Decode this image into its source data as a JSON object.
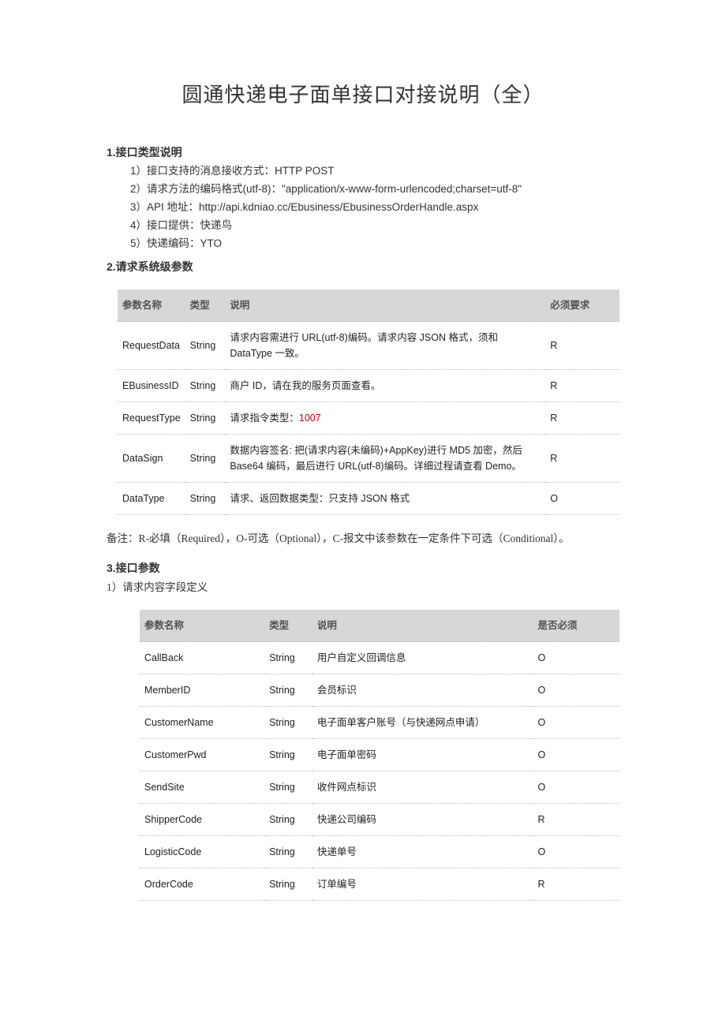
{
  "title": "圆通快递电子面单接口对接说明（全）",
  "section1": {
    "heading": "1.接口类型说明",
    "items": [
      "1）接口支持的消息接收方式：HTTP POST",
      "2）请求方法的编码格式(utf-8)：\"application/x-www-form-urlencoded;charset=utf-8\"",
      "3）API 地址：http://api.kdniao.cc/Ebusiness/EbusinessOrderHandle.aspx",
      "4）接口提供：快递鸟",
      "5）快递编码：YTO"
    ]
  },
  "section2": {
    "heading": "2.请求系统级参数",
    "headers": {
      "name": "参数名称",
      "type": "类型",
      "desc": "说明",
      "req": "必须要求"
    },
    "rows": [
      {
        "name": "RequestData",
        "type": "String",
        "desc": "请求内容需进行 URL(utf-8)编码。请求内容 JSON 格式，须和 DataType 一致。",
        "req": "R"
      },
      {
        "name": "EBusinessID",
        "type": "String",
        "desc": "商户 ID，请在我的服务页面查看。",
        "req": "R"
      },
      {
        "name": "RequestType",
        "type": "String",
        "desc_pre": "请求指令类型：",
        "desc_red": "1007",
        "req": "R"
      },
      {
        "name": "DataSign",
        "type": "String",
        "desc": "数据内容签名: 把(请求内容(未编码)+AppKey)进行 MD5 加密，然后 Base64 编码，最后进行 URL(utf-8)编码。详细过程请查看 Demo。",
        "req": "R"
      },
      {
        "name": "DataType",
        "type": "String",
        "desc": "请求、返回数据类型：只支持 JSON 格式",
        "req": "O"
      }
    ]
  },
  "note": "备注：R-必填（Required），O-可选（Optional），C-报文中该参数在一定条件下可选（Conditional）。",
  "section3": {
    "heading": "3.接口参数",
    "sub": "1）请求内容字段定义",
    "headers": {
      "name": "参数名称",
      "type": "类型",
      "desc": "说明",
      "req": "是否必须"
    },
    "rows": [
      {
        "name": "CallBack",
        "type": "String",
        "desc": "用户自定义回调信息",
        "req": "O"
      },
      {
        "name": "MemberID",
        "type": "String",
        "desc": "会员标识",
        "req": "O"
      },
      {
        "name": "CustomerName",
        "type": "String",
        "desc": "电子面单客户账号（与快递网点申请）",
        "req": "O"
      },
      {
        "name": "CustomerPwd",
        "type": "String",
        "desc": "电子面单密码",
        "req": "O"
      },
      {
        "name": "SendSite",
        "type": "String",
        "desc": "收件网点标识",
        "req": "O"
      },
      {
        "name": "ShipperCode",
        "type": "String",
        "desc": "快递公司编码",
        "req": "R"
      },
      {
        "name": "LogisticCode",
        "type": "String",
        "desc": "快递单号",
        "req": "O"
      },
      {
        "name": "OrderCode",
        "type": "String",
        "desc": "订单编号",
        "req": "R"
      }
    ]
  }
}
